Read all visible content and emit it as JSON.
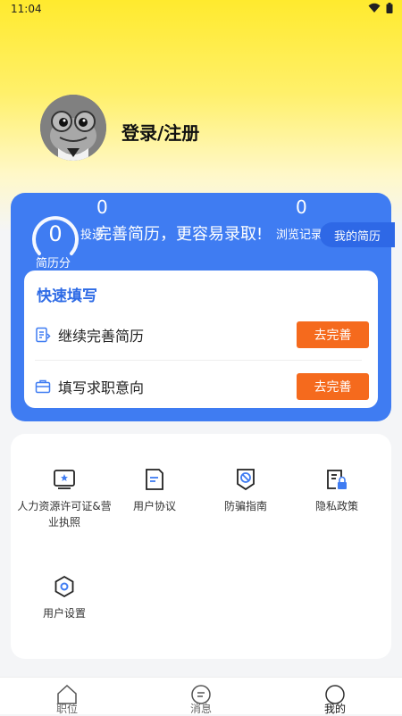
{
  "status_bar": {
    "time": "11:04"
  },
  "profile": {
    "login_label": "登录/注册"
  },
  "resume_card": {
    "score_value": "0",
    "score_label": "简历分",
    "stat1_value": "0",
    "stat1_label": "投递",
    "stat2_value": "0",
    "stat2_label": "浏览记录",
    "promo_text": "完善简历，更容易录取!",
    "my_resume_label": "我的简历",
    "quick": {
      "title": "快速填写",
      "items": [
        {
          "label": "继续完善简历",
          "button": "去完善"
        },
        {
          "label": "填写求职意向",
          "button": "去完善"
        }
      ]
    }
  },
  "services": [
    {
      "label": "人力资源许可证&营业执照"
    },
    {
      "label": "用户协议"
    },
    {
      "label": "防骗指南"
    },
    {
      "label": "隐私政策"
    },
    {
      "label": "用户设置"
    }
  ],
  "tabbar": {
    "tabs": [
      {
        "label": "职位"
      },
      {
        "label": "消息"
      },
      {
        "label": "我的"
      }
    ]
  },
  "colors": {
    "accent": "#3f7cf2",
    "button": "#f56a1d",
    "header": "#ffea2e"
  }
}
